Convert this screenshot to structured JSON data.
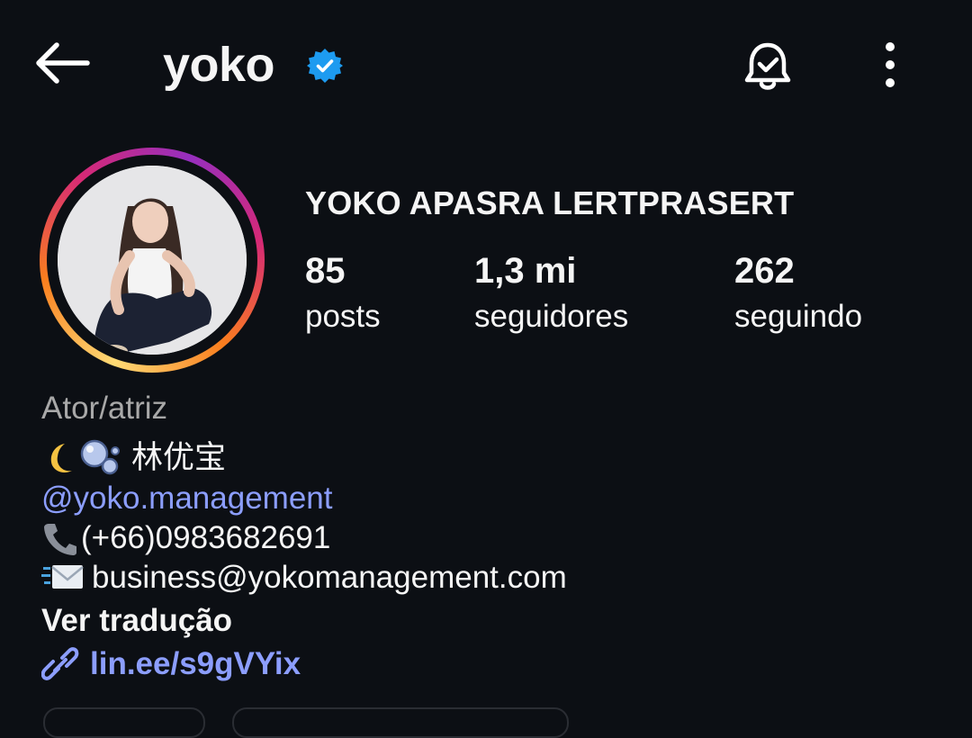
{
  "header": {
    "username": "yoko",
    "icons": {
      "back": "back-arrow-icon",
      "verified": "verified-badge-icon",
      "notifications": "bell-check-icon",
      "more": "more-vertical-icon"
    }
  },
  "profile": {
    "full_name": "YOKO APASRA LERTPRASERT",
    "stats": {
      "posts_value": "85",
      "posts_label": "posts",
      "followers_value": "1,3 mi",
      "followers_label": "seguidores",
      "following_value": "262",
      "following_label": "seguindo"
    }
  },
  "bio": {
    "category": "Ator/atriz",
    "line1_text": "林优宝",
    "threads_handle": "yoko.management",
    "phone": "(+66)0983682691",
    "email": "business@yokomanagement.com",
    "translate_label": "Ver tradução",
    "link": "lin.ee/s9gVYix"
  },
  "colors": {
    "background": "#0c0f14",
    "link": "#8c9eff",
    "verified": "#1d9bf0",
    "muted": "#a8a8a8"
  }
}
